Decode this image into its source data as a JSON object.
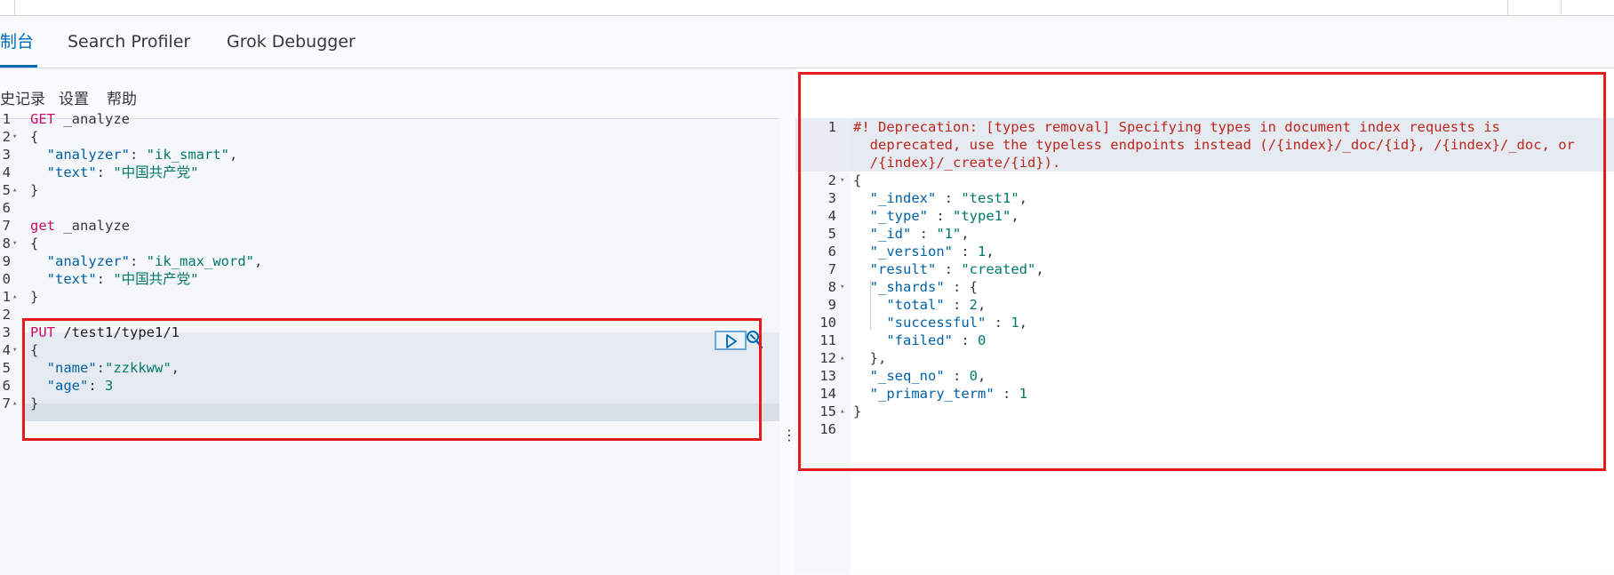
{
  "tabs": [
    {
      "label": "制台",
      "active": true
    },
    {
      "label": "Search Profiler",
      "active": false
    },
    {
      "label": "Grok Debugger",
      "active": false
    }
  ],
  "toolbar": {
    "history": "史记录",
    "settings": "设置",
    "help": "帮助"
  },
  "left_editor": {
    "lines": [
      {
        "n": "1",
        "fold": "",
        "parts": [
          [
            "kw",
            "GET"
          ],
          [
            "plain",
            " _analyze"
          ]
        ]
      },
      {
        "n": "2",
        "fold": "▾",
        "parts": [
          [
            "plain",
            "{"
          ]
        ]
      },
      {
        "n": "3",
        "fold": "",
        "parts": [
          [
            "plain",
            "  "
          ],
          [
            "key",
            "\"analyzer\""
          ],
          [
            "plain",
            ": "
          ],
          [
            "str",
            "\"ik_smart\""
          ],
          [
            "plain",
            ","
          ]
        ]
      },
      {
        "n": "4",
        "fold": "",
        "parts": [
          [
            "plain",
            "  "
          ],
          [
            "key",
            "\"text\""
          ],
          [
            "plain",
            ": "
          ],
          [
            "str",
            "\"中国共产党\""
          ]
        ]
      },
      {
        "n": "5",
        "fold": "▴",
        "parts": [
          [
            "plain",
            "}"
          ]
        ]
      },
      {
        "n": "6",
        "fold": "",
        "parts": []
      },
      {
        "n": "7",
        "fold": "",
        "parts": [
          [
            "kw",
            "get"
          ],
          [
            "plain",
            " _analyze"
          ]
        ]
      },
      {
        "n": "8",
        "fold": "▾",
        "parts": [
          [
            "plain",
            "{"
          ]
        ]
      },
      {
        "n": "9",
        "fold": "",
        "parts": [
          [
            "plain",
            "  "
          ],
          [
            "key",
            "\"analyzer\""
          ],
          [
            "plain",
            ": "
          ],
          [
            "str",
            "\"ik_max_word\""
          ],
          [
            "plain",
            ","
          ]
        ]
      },
      {
        "n": "0",
        "fold": "",
        "parts": [
          [
            "plain",
            "  "
          ],
          [
            "key",
            "\"text\""
          ],
          [
            "plain",
            ": "
          ],
          [
            "str",
            "\"中国共产党\""
          ]
        ]
      },
      {
        "n": "1",
        "fold": "▴",
        "parts": [
          [
            "plain",
            "}"
          ]
        ]
      },
      {
        "n": "2",
        "fold": "",
        "parts": []
      },
      {
        "n": "3",
        "fold": "",
        "parts": [
          [
            "kw",
            "PUT"
          ],
          [
            "path",
            " /test1/type1/1"
          ]
        ]
      },
      {
        "n": "4",
        "fold": "▾",
        "parts": [
          [
            "plain",
            "{"
          ]
        ]
      },
      {
        "n": "5",
        "fold": "",
        "parts": [
          [
            "plain",
            "  "
          ],
          [
            "key",
            "\"name\""
          ],
          [
            "plain",
            ":"
          ],
          [
            "str",
            "\"zzkkww\""
          ],
          [
            "plain",
            ","
          ]
        ]
      },
      {
        "n": "6",
        "fold": "",
        "parts": [
          [
            "plain",
            "  "
          ],
          [
            "key",
            "\"age\""
          ],
          [
            "plain",
            ": "
          ],
          [
            "num",
            "3"
          ]
        ]
      },
      {
        "n": "7",
        "fold": "▴",
        "parts": [
          [
            "plain",
            "}"
          ]
        ]
      }
    ]
  },
  "right_editor": {
    "lines": [
      {
        "n": "1",
        "fold": "",
        "parts": [
          [
            "warn",
            "#! Deprecation: [types removal] Specifying types in document index requests is"
          ]
        ]
      },
      {
        "n": "",
        "fold": "",
        "parts": [
          [
            "warn",
            "  deprecated, use the typeless endpoints instead (/{index}/_doc/{id}, /{index}/_doc, or"
          ]
        ]
      },
      {
        "n": "",
        "fold": "",
        "parts": [
          [
            "warn",
            "  /{index}/_create/{id})."
          ]
        ]
      },
      {
        "n": "2",
        "fold": "▾",
        "parts": [
          [
            "plain",
            "{"
          ]
        ]
      },
      {
        "n": "3",
        "fold": "",
        "parts": [
          [
            "plain",
            "  "
          ],
          [
            "key",
            "\"_index\""
          ],
          [
            "plain",
            " : "
          ],
          [
            "str",
            "\"test1\""
          ],
          [
            "plain",
            ","
          ]
        ]
      },
      {
        "n": "4",
        "fold": "",
        "parts": [
          [
            "plain",
            "  "
          ],
          [
            "key",
            "\"_type\""
          ],
          [
            "plain",
            " : "
          ],
          [
            "str",
            "\"type1\""
          ],
          [
            "plain",
            ","
          ]
        ]
      },
      {
        "n": "5",
        "fold": "",
        "parts": [
          [
            "plain",
            "  "
          ],
          [
            "key",
            "\"_id\""
          ],
          [
            "plain",
            " : "
          ],
          [
            "str",
            "\"1\""
          ],
          [
            "plain",
            ","
          ]
        ]
      },
      {
        "n": "6",
        "fold": "",
        "parts": [
          [
            "plain",
            "  "
          ],
          [
            "key",
            "\"_version\""
          ],
          [
            "plain",
            " : "
          ],
          [
            "num",
            "1"
          ],
          [
            "plain",
            ","
          ]
        ]
      },
      {
        "n": "7",
        "fold": "",
        "parts": [
          [
            "plain",
            "  "
          ],
          [
            "key",
            "\"result\""
          ],
          [
            "plain",
            " : "
          ],
          [
            "str",
            "\"created\""
          ],
          [
            "plain",
            ","
          ]
        ]
      },
      {
        "n": "8",
        "fold": "▾",
        "parts": [
          [
            "plain",
            "  "
          ],
          [
            "key",
            "\"_shards\""
          ],
          [
            "plain",
            " : {"
          ]
        ]
      },
      {
        "n": "9",
        "fold": "",
        "parts": [
          [
            "plain",
            "    "
          ],
          [
            "key",
            "\"total\""
          ],
          [
            "plain",
            " : "
          ],
          [
            "num",
            "2"
          ],
          [
            "plain",
            ","
          ]
        ]
      },
      {
        "n": "10",
        "fold": "",
        "parts": [
          [
            "plain",
            "    "
          ],
          [
            "key",
            "\"successful\""
          ],
          [
            "plain",
            " : "
          ],
          [
            "num",
            "1"
          ],
          [
            "plain",
            ","
          ]
        ]
      },
      {
        "n": "11",
        "fold": "",
        "parts": [
          [
            "plain",
            "    "
          ],
          [
            "key",
            "\"failed\""
          ],
          [
            "plain",
            " : "
          ],
          [
            "num",
            "0"
          ]
        ]
      },
      {
        "n": "12",
        "fold": "▴",
        "parts": [
          [
            "plain",
            "  },"
          ]
        ]
      },
      {
        "n": "13",
        "fold": "",
        "parts": [
          [
            "plain",
            "  "
          ],
          [
            "key",
            "\"_seq_no\""
          ],
          [
            "plain",
            " : "
          ],
          [
            "num",
            "0"
          ],
          [
            "plain",
            ","
          ]
        ]
      },
      {
        "n": "14",
        "fold": "",
        "parts": [
          [
            "plain",
            "  "
          ],
          [
            "key",
            "\"_primary_term\""
          ],
          [
            "plain",
            " : "
          ],
          [
            "num",
            "1"
          ]
        ]
      },
      {
        "n": "15",
        "fold": "▴",
        "parts": [
          [
            "plain",
            "}"
          ]
        ]
      },
      {
        "n": "16",
        "fold": "",
        "parts": []
      }
    ]
  },
  "colors": {
    "accent": "#006bb4",
    "annotation_box": "#e8191b",
    "keyword": "#c80a68",
    "json_key": "#0061a6",
    "json_string": "#00796b",
    "warning": "#bd271e"
  },
  "icons": {
    "run": "play-icon",
    "wrench": "wrench-icon",
    "resize": "vertical-dots-icon"
  }
}
